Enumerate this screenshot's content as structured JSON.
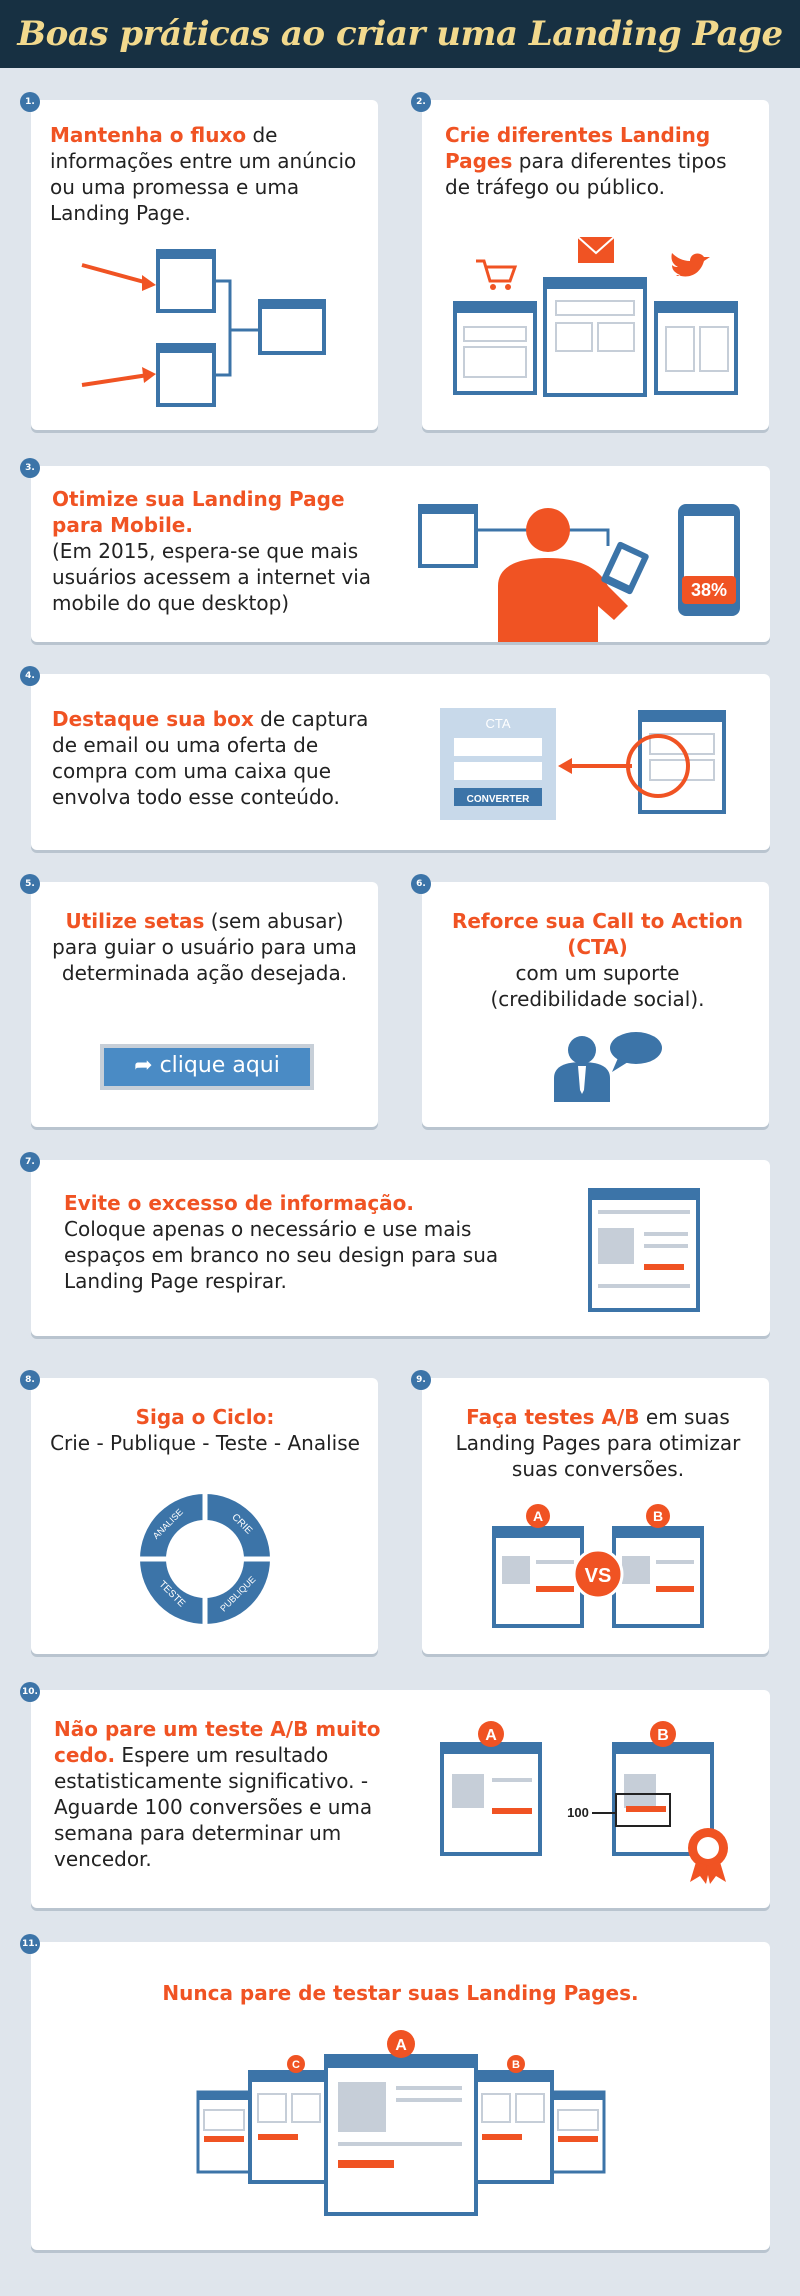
{
  "title": "Boas práticas ao criar uma Landing Page",
  "colors": {
    "accent": "#f05323",
    "blue": "#3c74a8",
    "dark": "#173042"
  },
  "cards": {
    "c1": {
      "num": "1.",
      "hl": "Mantenha o fluxo",
      "text": " de informações entre um anúncio ou uma promessa e uma Landing Page."
    },
    "c2": {
      "num": "2.",
      "hl": "Crie diferentes Landing Pages",
      "text": " para diferentes tipos de tráfego ou público."
    },
    "c3": {
      "num": "3.",
      "hl": "Otimize sua Landing Page para Mobile.",
      "text": "(Em 2015, espera-se que mais usuários acessem a internet via mobile do que desktop)",
      "percent": "38%"
    },
    "c4": {
      "num": "4.",
      "hl": "Destaque sua box",
      "text": " de captura de email ou uma oferta de compra com uma caixa que envolva todo esse conteúdo.",
      "cta": "CTA",
      "convert": "CONVERTER"
    },
    "c5": {
      "num": "5.",
      "hl": "Utilize setas",
      "text": " (sem abusar) para guiar o usuário para uma determinada ação desejada.",
      "button": "clique aqui"
    },
    "c6": {
      "num": "6.",
      "hl": "Reforce sua Call to Action (CTA)",
      "text": "com um suporte (credibilidade social)."
    },
    "c7": {
      "num": "7.",
      "hl": "Evite o excesso de informação.",
      "text": "Coloque apenas o necessário e use mais espaços em branco no seu design para sua Landing Page respirar."
    },
    "c8": {
      "num": "8.",
      "hl": "Siga o Ciclo:",
      "text": "Crie - Publique - Teste - Analise",
      "cycle": [
        "CRIE",
        "PUBLIQUE",
        "TESTE",
        "ANALISE"
      ]
    },
    "c9": {
      "num": "9.",
      "hl": "Faça testes A/B",
      "text": " em suas Landing Pages para otimizar suas conversões.",
      "a": "A",
      "b": "B",
      "vs": "VS"
    },
    "c10": {
      "num": "10.",
      "hl": "Não pare um teste A/B muito cedo.",
      "text": " Espere um resultado estatisticamente significativo. - Aguarde 100 conversões e uma semana para determinar um vencedor.",
      "a": "A",
      "b": "B",
      "count": "100"
    },
    "c11": {
      "num": "11.",
      "hl": "Nunca pare de testar suas Landing Pages.",
      "a": "A",
      "b": "B",
      "c": "C"
    }
  }
}
